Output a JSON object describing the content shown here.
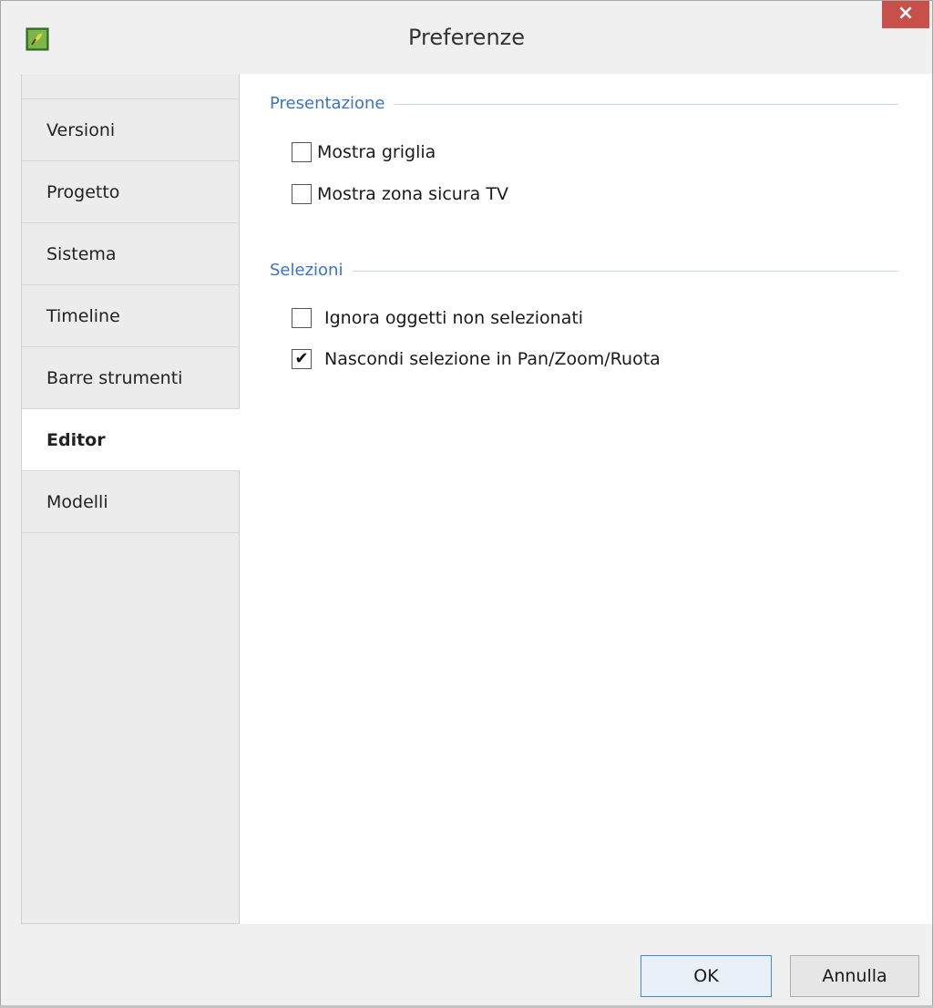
{
  "window": {
    "title": "Preferenze",
    "close_glyph": "×",
    "icon": "app-icon"
  },
  "sidebar": {
    "items": [
      {
        "label": "Versioni",
        "selected": false
      },
      {
        "label": "Progetto",
        "selected": false
      },
      {
        "label": "Sistema",
        "selected": false
      },
      {
        "label": "Timeline",
        "selected": false
      },
      {
        "label": "Barre strumenti",
        "selected": false
      },
      {
        "label": "Editor",
        "selected": true
      },
      {
        "label": "Modelli",
        "selected": false
      }
    ]
  },
  "groups": {
    "presentazione": {
      "label": "Presentazione",
      "options": [
        {
          "label": "Mostra griglia",
          "checked": false
        },
        {
          "label": "Mostra zona sicura TV",
          "checked": false
        }
      ]
    },
    "selezioni": {
      "label": "Selezioni",
      "options": [
        {
          "label": "Ignora oggetti non selezionati",
          "checked": false
        },
        {
          "label": "Nascondi selezione in Pan/Zoom/Ruota",
          "checked": true
        }
      ]
    }
  },
  "buttons": {
    "ok": "OK",
    "cancel": "Annulla"
  },
  "check_glyph": "✔",
  "colors": {
    "accent": "#3c74c4",
    "close": "#c7504b"
  }
}
